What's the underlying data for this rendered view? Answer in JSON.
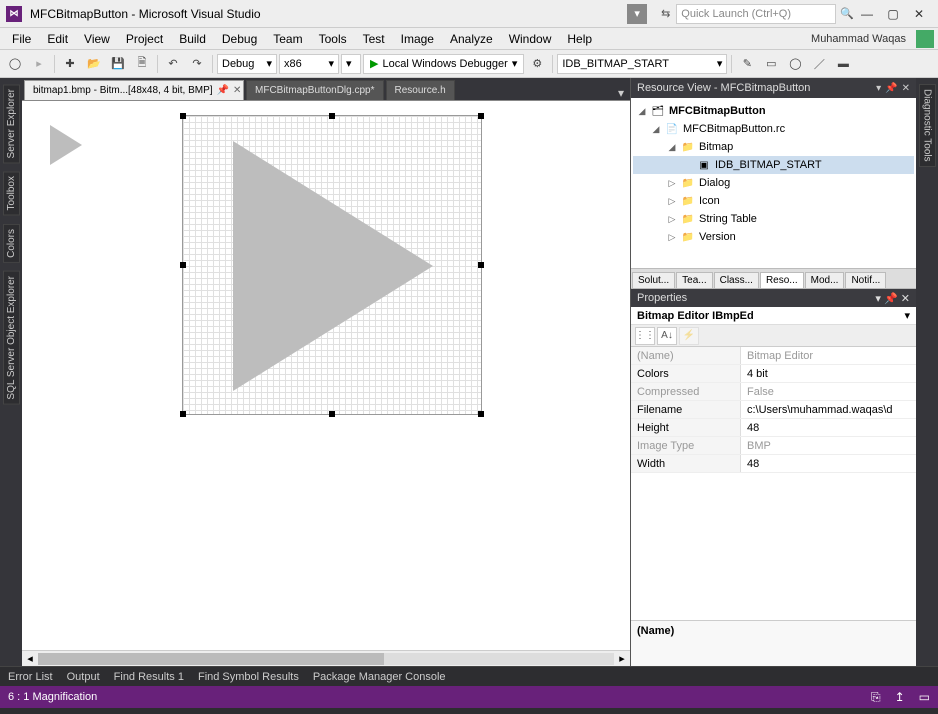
{
  "title": "MFCBitmapButton - Microsoft Visual Studio",
  "quicklaunch_placeholder": "Quick Launch (Ctrl+Q)",
  "user_name": "Muhammad Waqas",
  "menu": [
    "File",
    "Edit",
    "View",
    "Project",
    "Build",
    "Debug",
    "Team",
    "Tools",
    "Test",
    "Image",
    "Analyze",
    "Window",
    "Help"
  ],
  "toolbar": {
    "config": "Debug",
    "platform": "x86",
    "run_label": "Local Windows Debugger",
    "resource_combo": "IDB_BITMAP_START"
  },
  "editor_tabs": [
    {
      "label": "bitmap1.bmp - Bitm...[48x48, 4 bit, BMP]",
      "active": true,
      "dirty": false
    },
    {
      "label": "MFCBitmapButtonDlg.cpp*",
      "active": false,
      "dirty": true
    },
    {
      "label": "Resource.h",
      "active": false,
      "dirty": false
    }
  ],
  "left_tabs": [
    "Server Explorer",
    "Toolbox",
    "Colors",
    "SQL Server Object Explorer"
  ],
  "right_tabs": [
    "Diagnostic Tools"
  ],
  "resource_view": {
    "title": "Resource View - MFCBitmapButton",
    "tree": {
      "root": "MFCBitmapButton",
      "rc": "MFCBitmapButton.rc",
      "bitmap_folder": "Bitmap",
      "bitmap_item": "IDB_BITMAP_START",
      "others": [
        "Dialog",
        "Icon",
        "String Table",
        "Version"
      ]
    }
  },
  "side_tabs": [
    "Solut...",
    "Tea...",
    "Class...",
    "Reso...",
    "Mod...",
    "Notif..."
  ],
  "side_tabs_active": 3,
  "properties": {
    "title": "Properties",
    "object": "Bitmap Editor  IBmpEd",
    "rows": [
      {
        "k": "(Name)",
        "v": "Bitmap Editor",
        "disabled": true
      },
      {
        "k": "Colors",
        "v": "4 bit",
        "disabled": false
      },
      {
        "k": "Compressed",
        "v": "False",
        "disabled": true
      },
      {
        "k": "Filename",
        "v": "c:\\Users\\muhammad.waqas\\d",
        "disabled": false
      },
      {
        "k": "Height",
        "v": "48",
        "disabled": false
      },
      {
        "k": "Image Type",
        "v": "BMP",
        "disabled": true
      },
      {
        "k": "Width",
        "v": "48",
        "disabled": false
      }
    ],
    "help_label": "(Name)"
  },
  "bottom_tabs": [
    "Error List",
    "Output",
    "Find Results 1",
    "Find Symbol Results",
    "Package Manager Console"
  ],
  "status_text": "6 : 1 Magnification"
}
